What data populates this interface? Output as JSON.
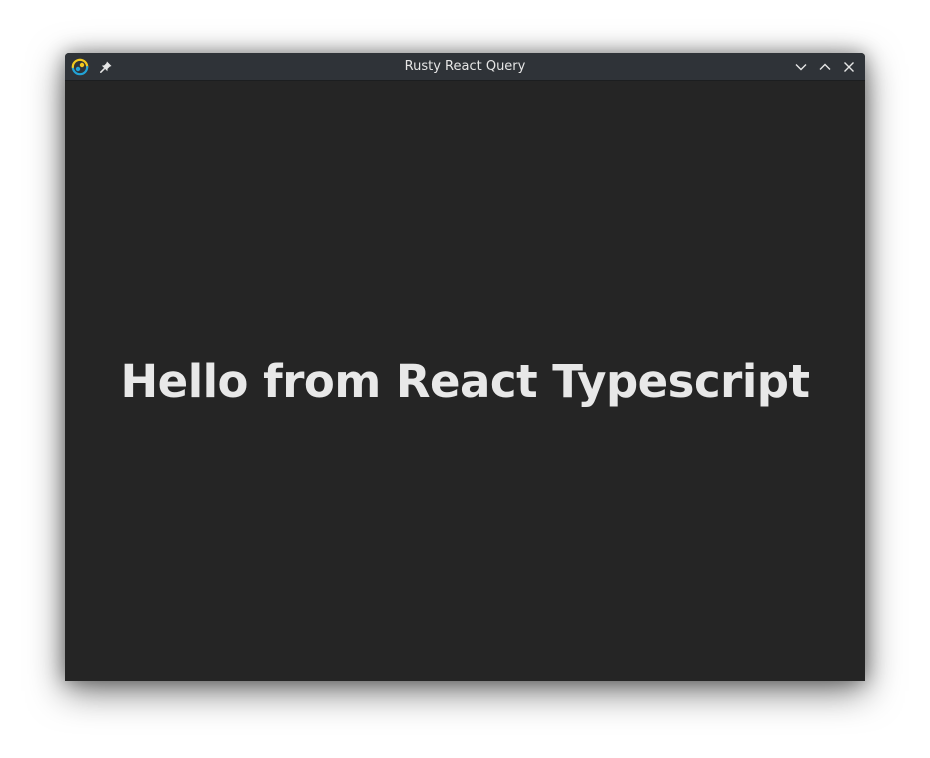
{
  "window": {
    "title": "Rusty React Query",
    "icons": {
      "app": "app-logo-icon",
      "pin": "pin-icon",
      "minimize": "chevron-down-icon",
      "maximize": "chevron-up-icon",
      "close": "close-icon"
    }
  },
  "main": {
    "heading": "Hello from React Typescript"
  },
  "colors": {
    "background": "#252525",
    "titlebar": "#2f3338",
    "text": "#e8e8e8",
    "logo_yellow": "#f2c81e",
    "logo_blue": "#22a3d6"
  }
}
